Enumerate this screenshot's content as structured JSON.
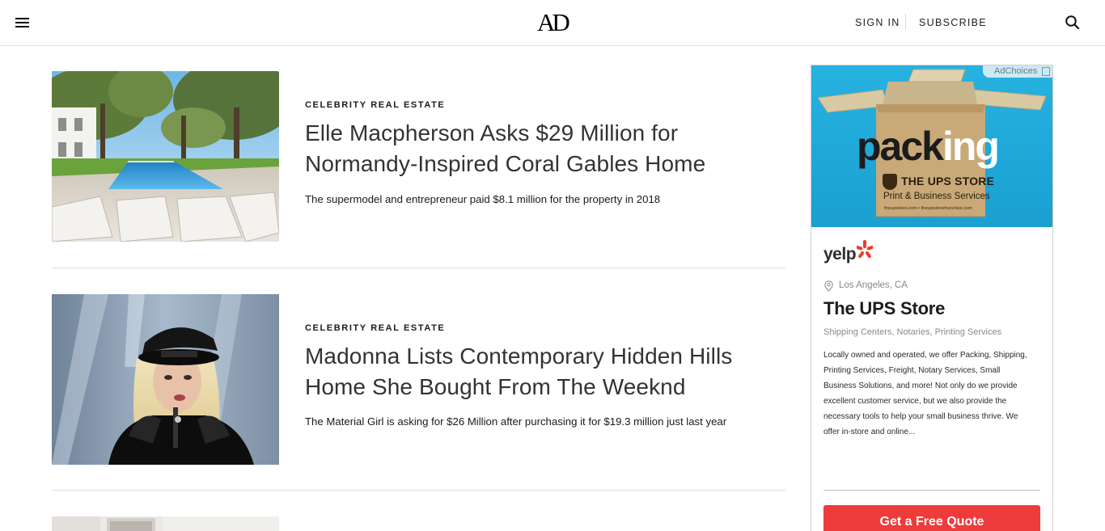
{
  "header": {
    "logo": "AD",
    "sign_in": "SIGN IN",
    "subscribe": "SUBSCRIBE"
  },
  "articles": [
    {
      "rubric": "CELEBRITY REAL ESTATE",
      "headline": "Elle Macpherson Asks $29 Million for Normandy-Inspired Coral Gables Home",
      "dek": "The supermodel and entrepreneur paid $8.1 million for the property in 2018"
    },
    {
      "rubric": "CELEBRITY REAL ESTATE",
      "headline": "Madonna Lists Contemporary Hidden Hills Home She Bought From The Weeknd",
      "dek": "The Material Girl is asking for $26 Million after purchasing it for $19.3 million just last year"
    }
  ],
  "ad": {
    "adchoices": "AdChoices",
    "box_word_dark": "pack",
    "box_word_light": "ing",
    "box_brand": "THE UPS STORE",
    "box_tagline": "Print & Business Services",
    "box_url": "theupsstore.com • theupsstorefranchise.com",
    "yelp_logo": "yelp",
    "location": "Los Angeles, CA",
    "business_name": "The UPS Store",
    "categories": "Shipping Centers, Notaries, Printing Services",
    "description": "Locally owned and operated, we offer Packing, Shipping, Printing Services, Freight, Notary Services, Small Business Solutions, and more! Not only do we provide excellent customer service, but we also provide the necessary tools to help your small business thrive. We offer in-store and online...",
    "cta": "Get a Free Quote"
  },
  "colors": {
    "ad_blue": "#1ea7d8",
    "cta_red": "#ee3b3b",
    "yelp_red": "#ef3b2d"
  }
}
